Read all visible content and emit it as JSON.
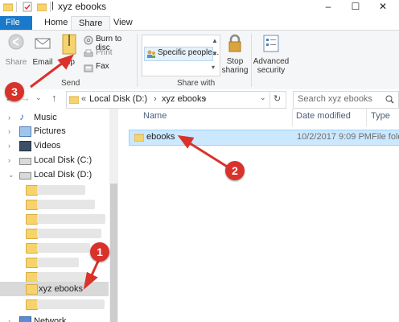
{
  "window": {
    "title": "xyz ebooks",
    "controls": {
      "minimize": "–",
      "maximize": "☐",
      "close": "✕"
    }
  },
  "ribbon": {
    "tabs": [
      {
        "label": "File"
      },
      {
        "label": "Home"
      },
      {
        "label": "Share",
        "active": true
      },
      {
        "label": "View"
      }
    ],
    "send_group": {
      "label": "Send",
      "share": "Share",
      "email": "Email",
      "zip": "Zip",
      "burn": "Burn to disc",
      "print": "Print",
      "fax": "Fax"
    },
    "share_with_group": {
      "label": "Share with",
      "specific_people": "Specific people...",
      "stop_sharing_1": "Stop",
      "stop_sharing_2": "sharing"
    },
    "advanced_security_1": "Advanced",
    "advanced_security_2": "security"
  },
  "address": {
    "overflow": "«",
    "segments": [
      "Local Disk (D:)",
      "xyz ebooks"
    ],
    "separator": "›",
    "search_placeholder": "Search xyz ebooks"
  },
  "nav_pane": {
    "items": [
      {
        "label": "Music",
        "icon": "music-icon"
      },
      {
        "label": "Pictures",
        "icon": "pictures-icon"
      },
      {
        "label": "Videos",
        "icon": "videos-icon"
      },
      {
        "label": "Local Disk (C:)",
        "icon": "drive-icon"
      },
      {
        "label": "Local Disk (D:)",
        "icon": "drive-icon"
      },
      {
        "label": "xyz ebooks",
        "icon": "folder-icon",
        "selected": true
      }
    ],
    "partial_item": "Network"
  },
  "content": {
    "columns": [
      "Name",
      "Date modified",
      "Type"
    ],
    "rows": [
      {
        "name": "ebooks",
        "date": "10/2/2017 9:09 PM",
        "type": "File folder"
      }
    ]
  },
  "annotations": {
    "badges": [
      "1",
      "2",
      "3"
    ],
    "color": "#d9322b"
  }
}
